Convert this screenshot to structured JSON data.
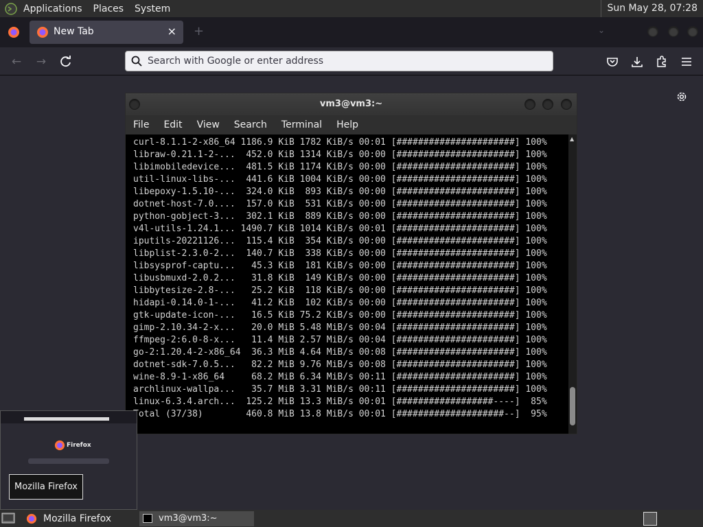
{
  "top_panel": {
    "menus": [
      "Applications",
      "Places",
      "System"
    ],
    "clock": "Sun May 28, 07:28"
  },
  "firefox": {
    "tab_title": "New Tab",
    "tab_close": "×",
    "new_tab": "+",
    "url_placeholder": "Search with Google or enter address"
  },
  "terminal": {
    "title": "vm3@vm3:~",
    "menus": [
      "File",
      "Edit",
      "View",
      "Search",
      "Terminal",
      "Help"
    ],
    "rows": [
      {
        "name": "curl-8.1.1-2-x86_64",
        "size": "1186.9 KiB",
        "speed": "1782 KiB/s",
        "time": "00:01",
        "bar": "[######################]",
        "pct": "100%"
      },
      {
        "name": "libraw-0.21.1-2-...",
        "size": "452.0 KiB",
        "speed": "1314 KiB/s",
        "time": "00:00",
        "bar": "[######################]",
        "pct": "100%"
      },
      {
        "name": "libimobiledevice...",
        "size": "481.5 KiB",
        "speed": "1174 KiB/s",
        "time": "00:00",
        "bar": "[######################]",
        "pct": "100%"
      },
      {
        "name": "util-linux-libs-...",
        "size": "441.6 KiB",
        "speed": "1004 KiB/s",
        "time": "00:00",
        "bar": "[######################]",
        "pct": "100%"
      },
      {
        "name": "libepoxy-1.5.10-...",
        "size": "324.0 KiB",
        "speed": "893 KiB/s",
        "time": "00:00",
        "bar": "[######################]",
        "pct": "100%"
      },
      {
        "name": "dotnet-host-7.0....",
        "size": "157.0 KiB",
        "speed": "531 KiB/s",
        "time": "00:00",
        "bar": "[######################]",
        "pct": "100%"
      },
      {
        "name": "python-gobject-3...",
        "size": "302.1 KiB",
        "speed": "889 KiB/s",
        "time": "00:00",
        "bar": "[######################]",
        "pct": "100%"
      },
      {
        "name": "v4l-utils-1.24.1...",
        "size": "1490.7 KiB",
        "speed": "1014 KiB/s",
        "time": "00:01",
        "bar": "[######################]",
        "pct": "100%"
      },
      {
        "name": "iputils-20221126...",
        "size": "115.4 KiB",
        "speed": "354 KiB/s",
        "time": "00:00",
        "bar": "[######################]",
        "pct": "100%"
      },
      {
        "name": "libplist-2.3.0-2...",
        "size": "140.7 KiB",
        "speed": "338 KiB/s",
        "time": "00:00",
        "bar": "[######################]",
        "pct": "100%"
      },
      {
        "name": "libsysprof-captu...",
        "size": "45.3 KiB",
        "speed": "181 KiB/s",
        "time": "00:00",
        "bar": "[######################]",
        "pct": "100%"
      },
      {
        "name": "libusbmuxd-2.0.2...",
        "size": "31.8 KiB",
        "speed": "149 KiB/s",
        "time": "00:00",
        "bar": "[######################]",
        "pct": "100%"
      },
      {
        "name": "libbytesize-2.8-...",
        "size": "25.2 KiB",
        "speed": "118 KiB/s",
        "time": "00:00",
        "bar": "[######################]",
        "pct": "100%"
      },
      {
        "name": "hidapi-0.14.0-1-...",
        "size": "41.2 KiB",
        "speed": "102 KiB/s",
        "time": "00:00",
        "bar": "[######################]",
        "pct": "100%"
      },
      {
        "name": "gtk-update-icon-...",
        "size": "16.5 KiB",
        "speed": "75.2 KiB/s",
        "time": "00:00",
        "bar": "[######################]",
        "pct": "100%"
      },
      {
        "name": "gimp-2.10.34-2-x...",
        "size": "20.0 MiB",
        "speed": "5.48 MiB/s",
        "time": "00:04",
        "bar": "[######################]",
        "pct": "100%"
      },
      {
        "name": "ffmpeg-2:6.0-8-x...",
        "size": "11.4 MiB",
        "speed": "2.57 MiB/s",
        "time": "00:04",
        "bar": "[######################]",
        "pct": "100%"
      },
      {
        "name": "go-2:1.20.4-2-x86_64",
        "size": "36.3 MiB",
        "speed": "4.64 MiB/s",
        "time": "00:08",
        "bar": "[######################]",
        "pct": "100%"
      },
      {
        "name": "dotnet-sdk-7.0.5...",
        "size": "82.2 MiB",
        "speed": "9.76 MiB/s",
        "time": "00:08",
        "bar": "[######################]",
        "pct": "100%"
      },
      {
        "name": "wine-8.9-1-x86_64",
        "size": "68.2 MiB",
        "speed": "6.34 MiB/s",
        "time": "00:11",
        "bar": "[######################]",
        "pct": "100%"
      },
      {
        "name": "archlinux-wallpa...",
        "size": "35.7 MiB",
        "speed": "3.31 MiB/s",
        "time": "00:11",
        "bar": "[######################]",
        "pct": "100%"
      },
      {
        "name": "linux-6.3.4.arch...",
        "size": "125.2 MiB",
        "speed": "13.3 MiB/s",
        "time": "00:01",
        "bar": "[##################----]",
        "pct": "85%"
      },
      {
        "name": "Total (37/38)",
        "size": "460.8 MiB",
        "speed": "13.8 MiB/s",
        "time": "00:01",
        "bar": "[####################--]",
        "pct": "95%"
      }
    ]
  },
  "preview": {
    "brand": "Firefox"
  },
  "tooltip": "Mozilla Firefox",
  "taskbar": {
    "firefox_label": "Mozilla Firefox",
    "terminal_label": "vm3@vm3:~"
  },
  "icons": [
    "mate-logo-icon",
    "firefox-icon",
    "back-icon",
    "forward-icon",
    "reload-icon",
    "search-icon",
    "pocket-icon",
    "download-icon",
    "extensions-icon",
    "menu-icon",
    "gear-icon",
    "close-icon",
    "terminal-icon",
    "desktop-icon"
  ]
}
